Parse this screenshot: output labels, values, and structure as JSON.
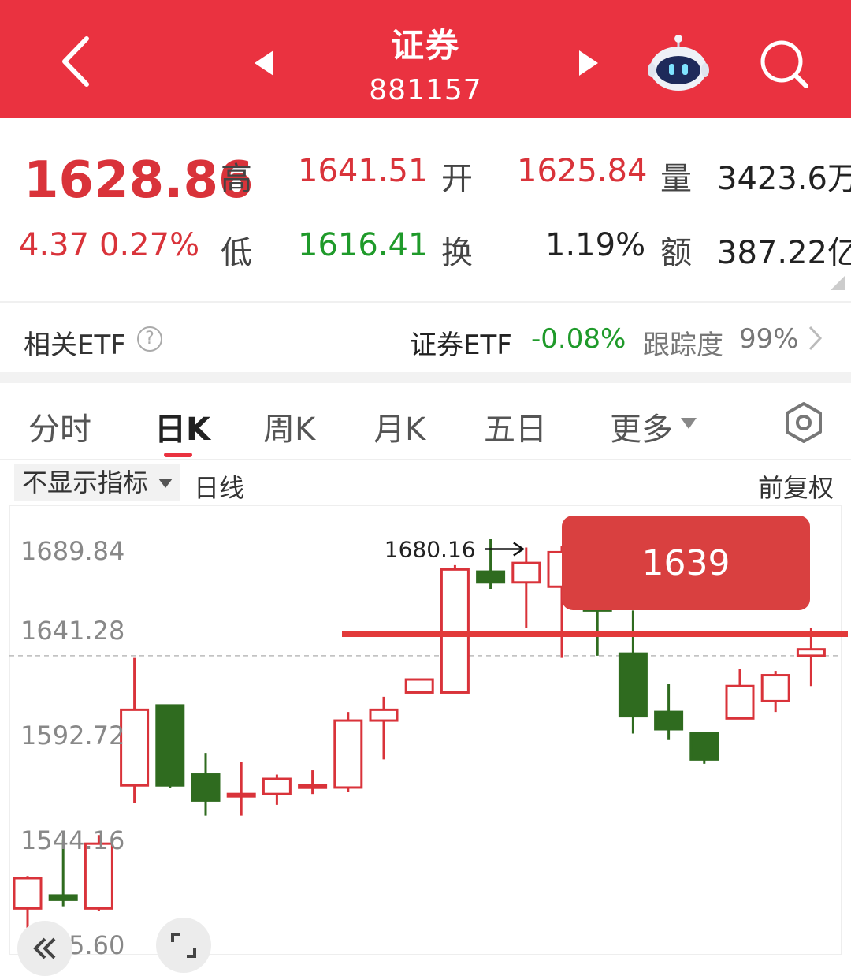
{
  "header": {
    "title": "证券",
    "code": "881157"
  },
  "quote": {
    "price": "1628.86",
    "change": "4.37",
    "change_pct": "0.27%",
    "high_label": "高",
    "high": "1641.51",
    "low_label": "低",
    "low": "1616.41",
    "open_label": "开",
    "open": "1625.84",
    "turnover_label": "换",
    "turnover": "1.19%",
    "volume_label": "量",
    "volume": "3423.6万",
    "amount_label": "额",
    "amount": "387.22亿"
  },
  "etf": {
    "label": "相关ETF",
    "help": "?",
    "name": "证券ETF",
    "change": "-0.08%",
    "track_label": "跟踪度",
    "track_value": "99%"
  },
  "tabs": [
    {
      "label": "分时"
    },
    {
      "label": "日K"
    },
    {
      "label": "周K"
    },
    {
      "label": "月K"
    },
    {
      "label": "五日"
    },
    {
      "label": "更多"
    }
  ],
  "indicator": {
    "toggle_label": "不显示指标",
    "line_label": "日线",
    "adjust_label": "前复权"
  },
  "chart_data": {
    "type": "candlestick",
    "y_ticks": [
      "1689.84",
      "1641.28",
      "1592.72",
      "1544.16",
      "1495.60"
    ],
    "ylim": [
      1495.6,
      1689.84
    ],
    "max_annotation": "1680.16",
    "price_line_label": "1639",
    "candles": [
      {
        "o": 1513,
        "c": 1527,
        "h": 1528,
        "l": 1495
      },
      {
        "o": 1519,
        "c": 1517,
        "h": 1545,
        "l": 1514
      },
      {
        "o": 1513,
        "c": 1543,
        "h": 1547,
        "l": 1512
      },
      {
        "o": 1570,
        "c": 1605,
        "h": 1629,
        "l": 1562
      },
      {
        "o": 1607,
        "c": 1570,
        "h": 1607,
        "l": 1569
      },
      {
        "o": 1575,
        "c": 1563,
        "h": 1585,
        "l": 1556
      },
      {
        "o": 1566,
        "c": 1566,
        "h": 1581,
        "l": 1556
      },
      {
        "o": 1566,
        "c": 1573,
        "h": 1575,
        "l": 1561
      },
      {
        "o": 1570,
        "c": 1570,
        "h": 1577,
        "l": 1566
      },
      {
        "o": 1569,
        "c": 1600,
        "h": 1604,
        "l": 1567
      },
      {
        "o": 1600,
        "c": 1605,
        "h": 1611,
        "l": 1582
      },
      {
        "o": 1613,
        "c": 1619,
        "h": 1619,
        "l": 1613
      },
      {
        "o": 1613,
        "c": 1670,
        "h": 1672,
        "l": 1613
      },
      {
        "o": 1669,
        "c": 1664,
        "h": 1684,
        "l": 1661
      },
      {
        "o": 1664,
        "c": 1673,
        "h": 1680.16,
        "l": 1643
      },
      {
        "o": 1662,
        "c": 1678,
        "h": 1681,
        "l": 1629
      },
      {
        "o": 1656,
        "c": 1651,
        "h": 1664,
        "l": 1630
      },
      {
        "o": 1631,
        "c": 1602,
        "h": 1651,
        "l": 1594
      },
      {
        "o": 1604,
        "c": 1596,
        "h": 1617,
        "l": 1591
      },
      {
        "o": 1594,
        "c": 1582,
        "h": 1594,
        "l": 1580
      },
      {
        "o": 1601,
        "c": 1616,
        "h": 1624,
        "l": 1601
      },
      {
        "o": 1609,
        "c": 1621,
        "h": 1623,
        "l": 1604
      },
      {
        "o": 1630,
        "c": 1633,
        "h": 1643,
        "l": 1616
      }
    ]
  },
  "colors": {
    "header_bg": "#ea3240",
    "up": "#d9333a",
    "down": "#2f6b1f",
    "etf_down": "#1f9a2a"
  }
}
